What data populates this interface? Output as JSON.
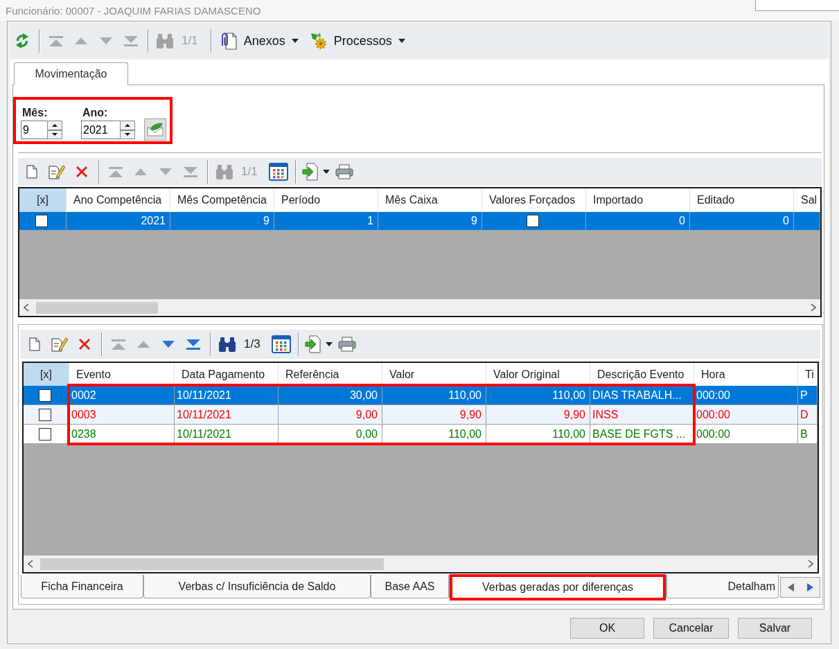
{
  "window": {
    "title": "Funcionário: 00007 - JOAQUIM FARIAS DAMASCENO"
  },
  "toolbar": {
    "items": [
      {
        "kind": "refresh",
        "disabled": false
      },
      {
        "kind": "separator"
      },
      {
        "kind": "first",
        "disabled": true
      },
      {
        "kind": "previous",
        "disabled": true
      },
      {
        "kind": "next",
        "disabled": true
      },
      {
        "kind": "last",
        "disabled": true
      },
      {
        "kind": "separator"
      },
      {
        "kind": "find",
        "disabled": true
      },
      {
        "kind": "counter",
        "text": "1/1",
        "disabled": true
      },
      {
        "kind": "separator"
      },
      {
        "kind": "attachments",
        "label": "Anexos",
        "disabled": false
      },
      {
        "kind": "processes",
        "label": "Processos",
        "disabled": false
      }
    ]
  },
  "tabs": [
    {
      "label": "Movimentação",
      "selected": true
    }
  ],
  "period": {
    "highlighted": true,
    "month": {
      "label": "Mês:",
      "value": "9"
    },
    "year": {
      "label": "Ano:",
      "value": "2021"
    }
  },
  "competence_grid": {
    "toolbar": [
      {
        "kind": "new",
        "disabled": false
      },
      {
        "kind": "edit",
        "disabled": false
      },
      {
        "kind": "delete",
        "disabled": false
      },
      {
        "kind": "separator"
      },
      {
        "kind": "first",
        "disabled": true
      },
      {
        "kind": "previous",
        "disabled": true
      },
      {
        "kind": "next",
        "disabled": true
      },
      {
        "kind": "last",
        "disabled": true
      },
      {
        "kind": "separator"
      },
      {
        "kind": "find",
        "disabled": true
      },
      {
        "kind": "counter",
        "text": "1/1",
        "disabled": true
      },
      {
        "kind": "columns",
        "disabled": false
      },
      {
        "kind": "separator"
      },
      {
        "kind": "export",
        "disabled": false
      },
      {
        "kind": "print",
        "disabled": false
      }
    ],
    "columns": [
      {
        "label": "[x]",
        "kind": "checkbox"
      },
      {
        "label": "Ano Competência",
        "kind": "number"
      },
      {
        "label": "Mês Competência",
        "kind": "number"
      },
      {
        "label": "Período",
        "kind": "number"
      },
      {
        "label": "Mês Caixa",
        "kind": "number"
      },
      {
        "label": "Valores Forçados",
        "kind": "checkbox"
      },
      {
        "label": "Importado",
        "kind": "number"
      },
      {
        "label": "Editado",
        "kind": "number"
      },
      {
        "label": "Sal"
      }
    ],
    "rows": [
      {
        "selected": true,
        "cells": [
          {
            "checked": false
          },
          {
            "text": "2021"
          },
          {
            "text": "9"
          },
          {
            "text": "1"
          },
          {
            "text": "9"
          },
          {
            "checked": false
          },
          {
            "text": "0"
          },
          {
            "text": "0"
          }
        ]
      }
    ]
  },
  "events_grid": {
    "toolbar": [
      {
        "kind": "new",
        "disabled": false
      },
      {
        "kind": "edit",
        "disabled": false
      },
      {
        "kind": "delete",
        "disabled": false
      },
      {
        "kind": "separator"
      },
      {
        "kind": "first",
        "disabled": true
      },
      {
        "kind": "previous",
        "disabled": true
      },
      {
        "kind": "next",
        "disabled": false
      },
      {
        "kind": "last",
        "disabled": false
      },
      {
        "kind": "separator"
      },
      {
        "kind": "find",
        "disabled": false
      },
      {
        "kind": "counter",
        "text": "1/3",
        "disabled": false
      },
      {
        "kind": "columns",
        "disabled": false
      },
      {
        "kind": "separator"
      },
      {
        "kind": "export",
        "disabled": false
      },
      {
        "kind": "print",
        "disabled": false
      }
    ],
    "columns": [
      {
        "label": "[x]",
        "kind": "checkbox"
      },
      {
        "label": "Evento",
        "kind": "text"
      },
      {
        "label": "Data Pagamento",
        "kind": "text"
      },
      {
        "label": "Referência",
        "kind": "number"
      },
      {
        "label": "Valor",
        "kind": "number"
      },
      {
        "label": "Valor Original",
        "kind": "number"
      },
      {
        "label": "Descrição Evento",
        "kind": "text"
      },
      {
        "label": "Hora",
        "kind": "text"
      },
      {
        "label": "Ti",
        "kind": "text"
      }
    ],
    "rows_highlighted": true,
    "rows": [
      {
        "selected": true,
        "cells": [
          {
            "checked": false
          },
          {
            "text": "0002"
          },
          {
            "text": "10/11/2021"
          },
          {
            "text": "30,00"
          },
          {
            "text": "110,00"
          },
          {
            "text": "110,00"
          },
          {
            "text": "DIAS TRABALH..."
          },
          {
            "text": "000:00"
          },
          {
            "text": "P"
          }
        ]
      },
      {
        "selected": false,
        "color": "#ff0000",
        "cells": [
          {
            "checked": false
          },
          {
            "text": "0003"
          },
          {
            "text": "10/11/2021"
          },
          {
            "text": "9,00"
          },
          {
            "text": "9,90"
          },
          {
            "text": "9,90"
          },
          {
            "text": "INSS"
          },
          {
            "text": "000:00"
          },
          {
            "text": "D"
          }
        ]
      },
      {
        "selected": false,
        "color": "#008000",
        "cells": [
          {
            "checked": false
          },
          {
            "text": "0238"
          },
          {
            "text": "10/11/2021"
          },
          {
            "text": "0,00"
          },
          {
            "text": "110,00"
          },
          {
            "text": "110,00"
          },
          {
            "text": "BASE DE FGTS ..."
          },
          {
            "text": "000:00"
          },
          {
            "text": "B"
          }
        ]
      }
    ]
  },
  "bottom_tabs": [
    {
      "label": "Ficha Financeira",
      "selected": false,
      "highlighted": false
    },
    {
      "label": "Verbas c/ Insuficiência de Saldo",
      "selected": false,
      "highlighted": false
    },
    {
      "label": "Base AAS",
      "selected": false,
      "highlighted": false
    },
    {
      "label": "Verbas geradas por diferenças",
      "selected": true,
      "highlighted": true
    },
    {
      "label": "Detalham",
      "selected": false,
      "highlighted": false
    }
  ],
  "buttons": [
    "OK",
    "Cancelar",
    "Salvar"
  ]
}
